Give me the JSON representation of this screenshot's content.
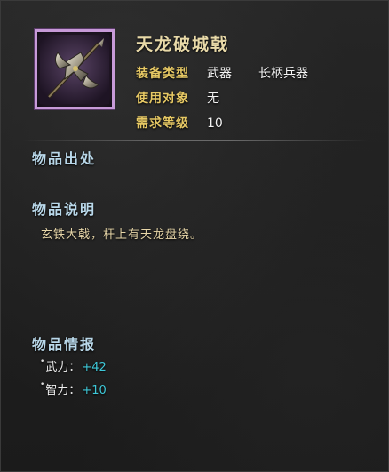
{
  "item": {
    "name": "天龙破城戟",
    "icon": "halberd-icon",
    "rarity_color": "#c79ad8"
  },
  "attributes": {
    "type_label": "装备类型",
    "type_value": "武器",
    "subtype_value": "长柄兵器",
    "target_label": "使用对象",
    "target_value": "无",
    "level_label": "需求等级",
    "level_value": "10"
  },
  "sections": {
    "source_title": "物品出处",
    "desc_title": "物品说明",
    "desc_text": "玄铁大戟，杆上有天龙盘绕。",
    "info_title": "物品情报"
  },
  "stats": [
    {
      "bullet": "•",
      "label": "武力：",
      "value": "+42"
    },
    {
      "bullet": "•",
      "label": "智力：",
      "value": "+10"
    }
  ],
  "colors": {
    "title": "#e8d9a8",
    "label": "#e6c864",
    "section": "#b9d8ea",
    "stat_value": "#3ec8d8"
  }
}
